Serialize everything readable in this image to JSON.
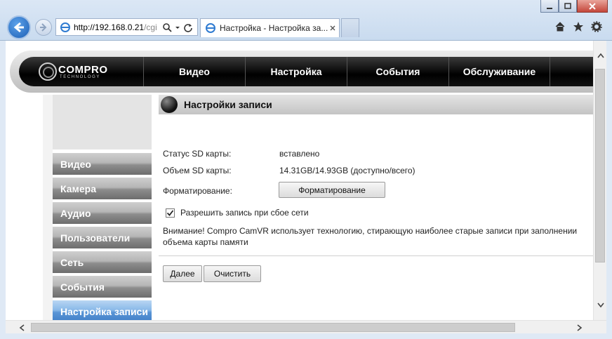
{
  "browser": {
    "url_host": "http://192.168.0.21",
    "url_path": "/cgi",
    "tab_title": "Настройка - Настройка за..."
  },
  "logo": {
    "name": "COMPRO",
    "tagline": "TECHNOLOGY"
  },
  "menu": [
    "Видео",
    "Настройка",
    "События",
    "Обслуживание"
  ],
  "sidebar": {
    "items": [
      {
        "label": "Видео",
        "active": false
      },
      {
        "label": "Камера",
        "active": false
      },
      {
        "label": "Аудио",
        "active": false
      },
      {
        "label": "Пользователи",
        "active": false
      },
      {
        "label": "Сеть",
        "active": false
      },
      {
        "label": "События",
        "active": false
      },
      {
        "label": "Настройка записи",
        "active": true
      }
    ]
  },
  "page": {
    "title": "Настройки записи",
    "sd_status_label": "Статус SD карты:",
    "sd_status_value": "вставлено",
    "sd_size_label": "Объем SD карты:",
    "sd_size_value": "14.31GB/14.93GB (доступно/всего)",
    "format_label": "Форматирование:",
    "format_button": "Форматирование",
    "network_fail_checkbox_label": "Разрешить запись при сбое сети",
    "network_fail_checked": true,
    "note": "Внимание! Compro CamVR использует технологию, стирающую наиболее старые записи при заполнении объема карты памяти",
    "next_button": "Далее",
    "clear_button": "Очистить"
  },
  "colors": {
    "active_sidebar": "#5a95d6",
    "banner": "#000000"
  }
}
